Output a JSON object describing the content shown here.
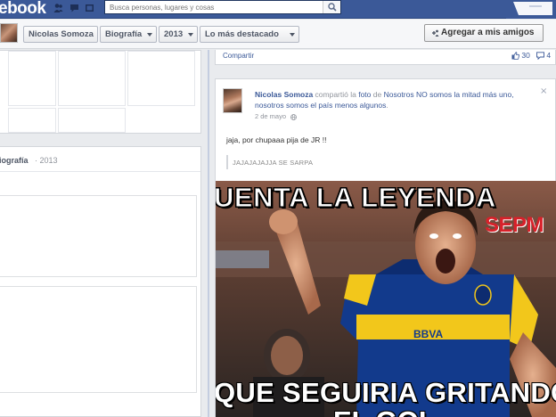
{
  "topbar": {
    "logo": "ebook",
    "search_placeholder": "Busca personas, lugares y cosas",
    "brand_color": "#3b5998"
  },
  "navbar": {
    "name": "Nicolas Somoza",
    "timeline": "Biografía",
    "year": "2013",
    "highlights": "Lo más destacado",
    "add_friend": "Agregar a mis amigos"
  },
  "left": {
    "section_title": "iografía",
    "section_year": "· 2013"
  },
  "top_card": {
    "share": "Compartir",
    "likes": "30",
    "comments": "4"
  },
  "post": {
    "author": "Nicolas Somoza",
    "action": " compartió la ",
    "photo_word": "foto",
    "of_word": " de ",
    "page_name": "Nosotros NO somos la mitad más uno, nosotros somos el país menos algunos",
    "end": ".",
    "close": "×",
    "date": "2 de mayo",
    "message": "jaja, por chupaaa pija de JR !!",
    "quote": "JAJAJAJAJJA SE SARPA"
  },
  "meme": {
    "top_text": "UENTA LA LEYENDA",
    "bottom_text": "QUE SEGUIRIA GRITANDO",
    "bottom_text2": "EL GOL",
    "watermark": "SEPM"
  }
}
